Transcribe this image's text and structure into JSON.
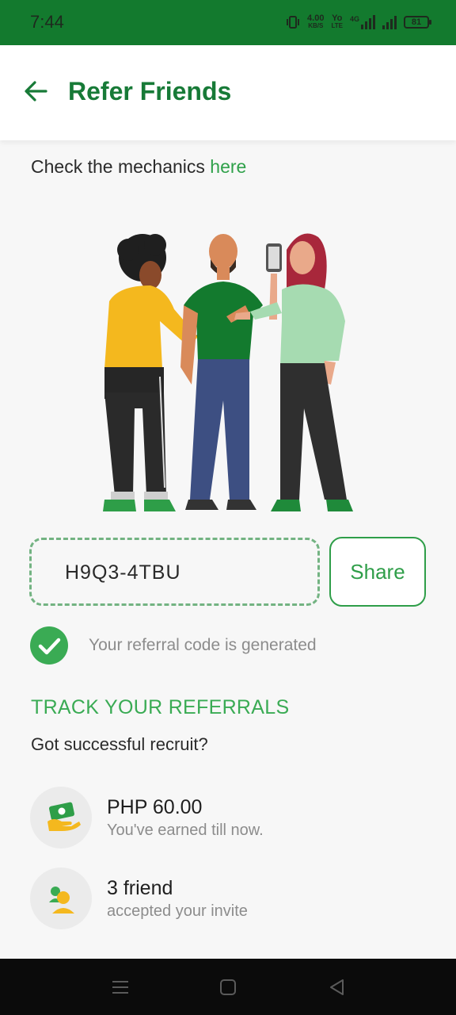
{
  "status_bar": {
    "time": "7:44",
    "speed_value": "4.00",
    "speed_unit": "KB/S",
    "volte_top": "Yo",
    "volte_bottom": "LTE",
    "network": "4G",
    "battery": "81"
  },
  "app_bar": {
    "title": "Refer Friends"
  },
  "mechanics": {
    "prefix": "Check the mechanics ",
    "link": "here"
  },
  "referral": {
    "code": "H9Q3-4TBU",
    "share_label": "Share",
    "generated_message": "Your referral code is generated"
  },
  "track": {
    "title": "TRACK YOUR REFERRALS",
    "subtitle": "Got successful recruit?",
    "stats": [
      {
        "value": "PHP 60.00",
        "label": "You've earned till now.",
        "icon": "money-hand-icon"
      },
      {
        "value": "3 friend",
        "label": "accepted your invite",
        "icon": "friends-icon"
      }
    ]
  },
  "colors": {
    "brand_green": "#137a2e",
    "accent_green": "#3aab54",
    "title_green": "#177a37"
  }
}
